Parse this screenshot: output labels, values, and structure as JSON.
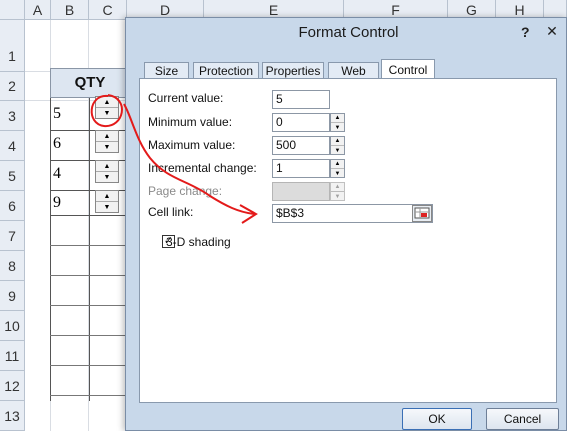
{
  "sheet": {
    "columns": [
      "A",
      "B",
      "C",
      "D",
      "E",
      "F",
      "G",
      "H"
    ],
    "rows": [
      "1",
      "2",
      "3",
      "4",
      "5",
      "6",
      "7",
      "8",
      "9",
      "10",
      "11",
      "12",
      "13"
    ],
    "qty_header": "QTY",
    "qty_values": [
      "5",
      "6",
      "4",
      "9"
    ]
  },
  "dialog": {
    "title": "Format Control",
    "help": "?",
    "close": "✕",
    "tabs": [
      "Size",
      "Protection",
      "Properties",
      "Web",
      "Control"
    ],
    "active_tab": "Control",
    "current_value_label": "Current value:",
    "current_value": "5",
    "minimum_value_label": "Minimum value:",
    "minimum_value": "0",
    "maximum_value_label": "Maximum value:",
    "maximum_value": "500",
    "incremental_change_label": "Incremental change:",
    "incremental_change": "1",
    "page_change_label": "Page change:",
    "page_change": "",
    "cell_link_label": "Cell link:",
    "cell_link": "$B$3",
    "shading_label": "3-D shading",
    "shading_checked": true,
    "ok_label": "OK",
    "cancel_label": "Cancel"
  },
  "annotation": {
    "color": "#e31a1a",
    "description_icon": "red-hand-drawn-arrow"
  }
}
